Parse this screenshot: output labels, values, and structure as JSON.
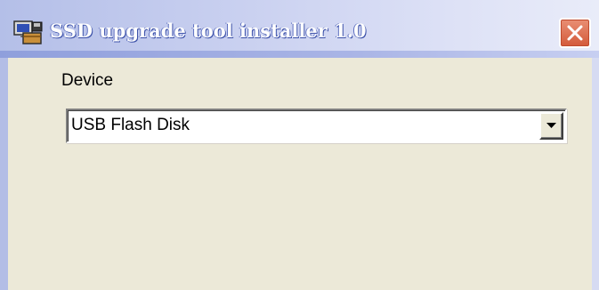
{
  "window": {
    "title": "SSD upgrade tool installer 1.0"
  },
  "form": {
    "device_label": "Device",
    "device_value": "USB Flash Disk"
  },
  "icons": {
    "app": "installer-computer-icon",
    "close": "close-icon",
    "dropdown": "chevron-down-icon"
  },
  "colors": {
    "titlebar": "#c2cbef",
    "client_background": "#ece9d8",
    "close_button": "#dc6a4a"
  }
}
